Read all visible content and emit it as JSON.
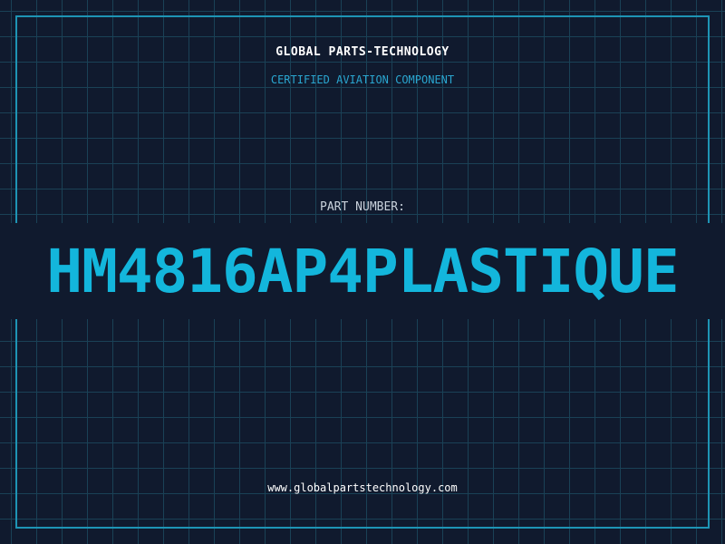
{
  "header": {
    "brand": "GLOBAL PARTS-TECHNOLOGY",
    "tagline": "CERTIFIED AVIATION COMPONENT"
  },
  "part": {
    "label": "PART NUMBER:",
    "number": "HM4816AP4PLASTIQUE"
  },
  "footer": {
    "website": "www.globalpartstechnology.com"
  },
  "colors": {
    "background": "#101a2e",
    "grid": "#1a4156",
    "frame": "#1e94b5",
    "accent": "#13b6dc",
    "tagline": "#2aa6d0",
    "text": "#ffffff",
    "label": "#c9d2dc"
  }
}
